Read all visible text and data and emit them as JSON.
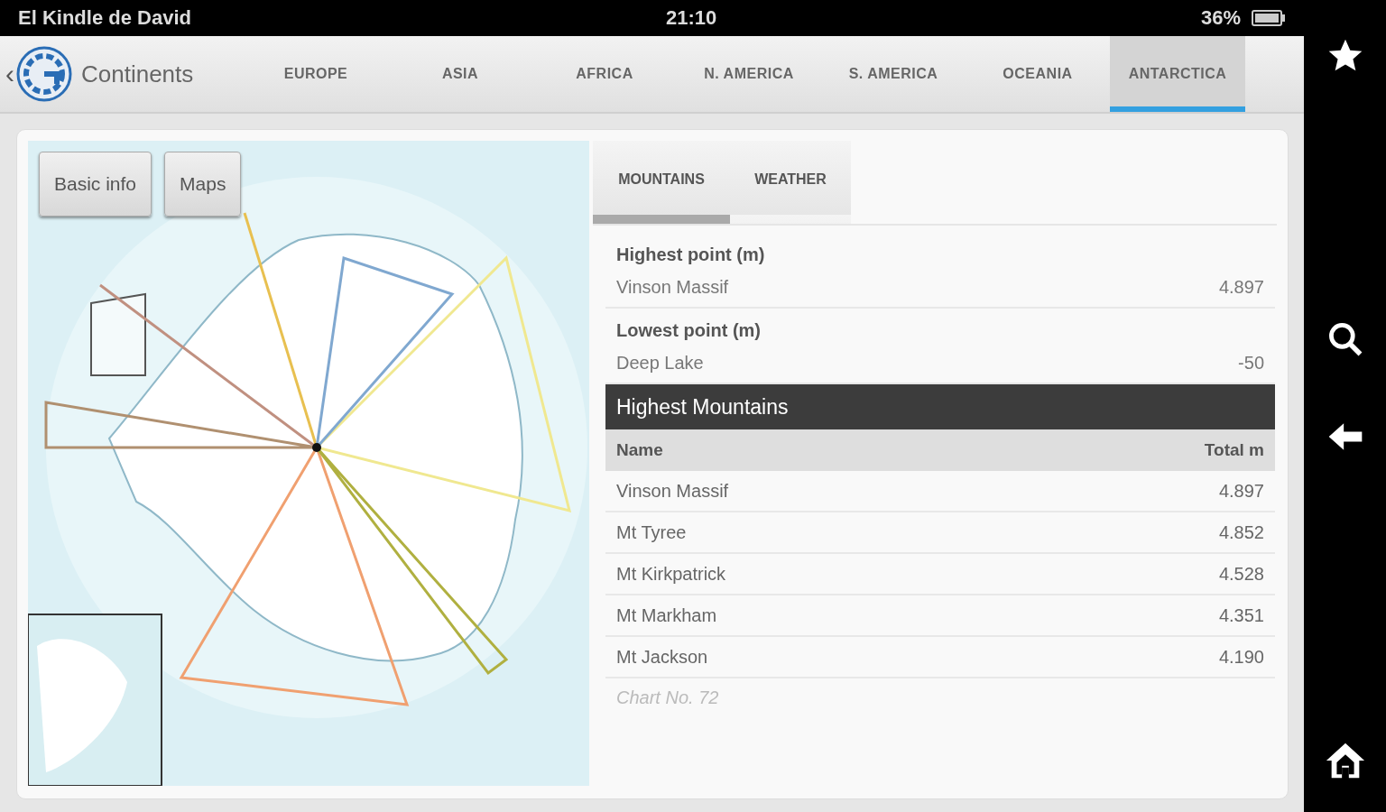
{
  "status_bar": {
    "device_name": "El Kindle de David",
    "time": "21:10",
    "battery": "36%"
  },
  "app_bar": {
    "back": "‹",
    "title": "Continents"
  },
  "tabs": [
    {
      "label": "EUROPE",
      "selected": false
    },
    {
      "label": "ASIA",
      "selected": false
    },
    {
      "label": "AFRICA",
      "selected": false
    },
    {
      "label": "N. AMERICA",
      "selected": false
    },
    {
      "label": "S. AMERICA",
      "selected": false
    },
    {
      "label": "OCEANIA",
      "selected": false
    },
    {
      "label": "ANTARCTICA",
      "selected": true
    }
  ],
  "map_panel": {
    "kind": "picture",
    "buttons": [
      "Basic info",
      "Maps"
    ]
  },
  "sub_tabs": [
    {
      "label": "MOUNTAINS",
      "selected": true
    },
    {
      "label": "WEATHER",
      "selected": false
    }
  ],
  "facts": [
    {
      "heading": "Highest point (m)",
      "name": "Vinson Massif",
      "value": "4.897"
    },
    {
      "heading": "Lowest point (m)",
      "name": "Deep Lake",
      "value": "-50"
    }
  ],
  "table": {
    "title": "Highest Mountains",
    "columns": [
      "Name",
      "Total m"
    ],
    "rows": [
      [
        "Vinson Massif",
        "4.897"
      ],
      [
        "Mt Tyree",
        "4.852"
      ],
      [
        "Mt Kirkpatrick",
        "4.528"
      ],
      [
        "Mt Markham",
        "4.351"
      ],
      [
        "Mt Jackson",
        "4.190"
      ]
    ],
    "footnote": "Chart No. 72"
  }
}
